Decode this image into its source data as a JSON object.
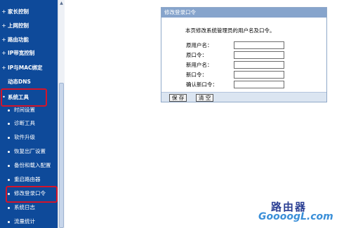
{
  "sidebar": {
    "items": [
      {
        "label": "家长控制"
      },
      {
        "label": "上网控制"
      },
      {
        "label": "路由功能"
      },
      {
        "label": "IP带宽控制"
      },
      {
        "label": "IP与MAC绑定"
      },
      {
        "label": "动态DNS"
      },
      {
        "label": "系统工具"
      }
    ],
    "subitems": [
      {
        "label": "时间设置"
      },
      {
        "label": "诊断工具"
      },
      {
        "label": "软件升级"
      },
      {
        "label": "恢复出厂设置"
      },
      {
        "label": "备份和载入配置"
      },
      {
        "label": "重启路由器"
      },
      {
        "label": "修改登录口令"
      },
      {
        "label": "系统日志"
      },
      {
        "label": "流量统计"
      }
    ],
    "expand_symbol": "+",
    "collapse_symbol": "•",
    "highlight_color": "#d4142a"
  },
  "panel": {
    "title": "修改登录口令",
    "description": "本页修改系统管理员的用户名及口令。",
    "fields": [
      {
        "label": "原用户名：",
        "value": ""
      },
      {
        "label": "原口令：",
        "value": ""
      },
      {
        "label": "新用户名：",
        "value": ""
      },
      {
        "label": "新口令：",
        "value": ""
      },
      {
        "label": "确认新口令：",
        "value": ""
      }
    ],
    "save_label": "保 存",
    "clear_label": "清 空"
  },
  "watermark": {
    "line1": "路由器",
    "line2": "GoooogL.com"
  }
}
